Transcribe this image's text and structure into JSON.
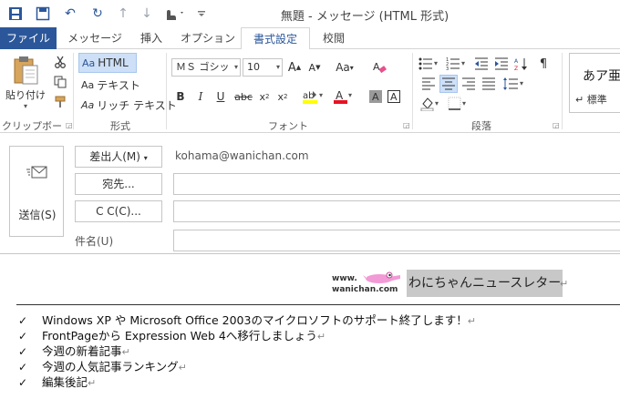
{
  "window": {
    "title": "無題 - メッセージ (HTML 形式)"
  },
  "tabs": [
    {
      "label": "ファイル"
    },
    {
      "label": "メッセージ"
    },
    {
      "label": "挿入"
    },
    {
      "label": "オプション"
    },
    {
      "label": "書式設定"
    },
    {
      "label": "校閲"
    }
  ],
  "ribbon": {
    "clipboard": {
      "label": "クリップボード",
      "paste": "貼り付け"
    },
    "format": {
      "label": "形式",
      "html": "HTML",
      "text": "テキスト",
      "rich": "リッチ テキスト",
      "html_prefix": "Aa",
      "text_prefix": "Aa",
      "rich_prefix": "Aa"
    },
    "font": {
      "label": "フォント",
      "font_name": "ＭＳ ゴシッ",
      "font_size": "10"
    },
    "paragraph": {
      "label": "段落"
    },
    "styles": {
      "preview": "あア亜",
      "label": "標準"
    }
  },
  "header": {
    "send": "送信(S)",
    "from_button": "差出人(M)",
    "from_value": "kohama@wanichan.com",
    "to_button": "宛先...",
    "cc_button": "C C(C)...",
    "subject_label": "件名(U)"
  },
  "body": {
    "logo_www": "www.",
    "logo_domain": "wanichan.com",
    "newsletter_title": "わにちゃんニュースレター",
    "items": [
      "Windows XP や Microsoft Office 2003のマイクロソフトのサポート終了します！",
      "FrontPageから Expression Web 4へ移行しましょう",
      "今週の新着記事",
      "今週の人気記事ランキング",
      "編集後記"
    ]
  }
}
